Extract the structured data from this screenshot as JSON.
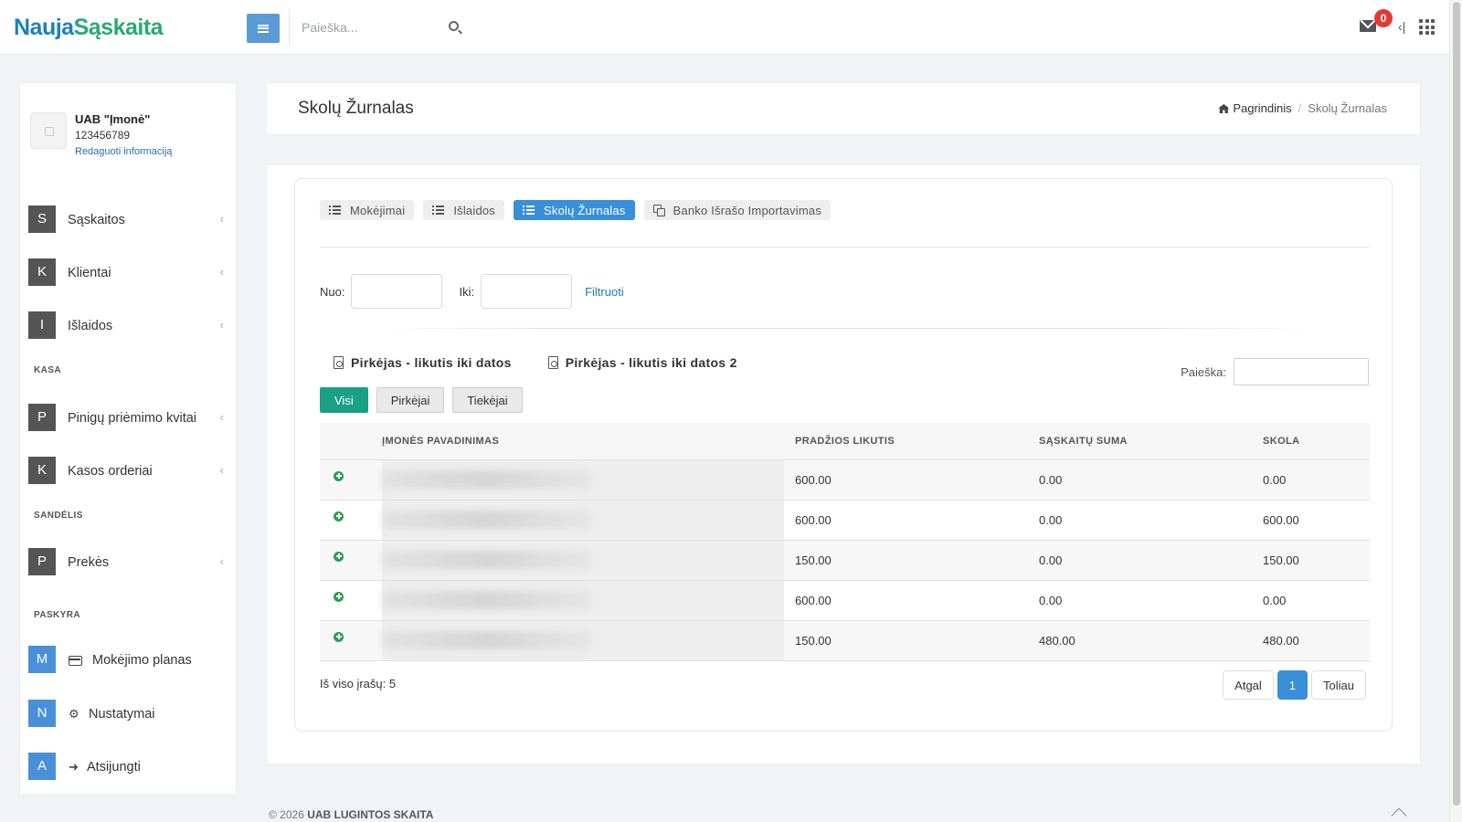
{
  "brand": {
    "part1": "Nauja",
    "part2": "Sąskaita"
  },
  "topbar": {
    "search_placeholder": "Paieška...",
    "mail_count": "0",
    "collapse_glyph": "‹|"
  },
  "profile": {
    "name": "UAB \"Įmonė\"",
    "code": "123456789",
    "edit_link": "Redaguoti informaciją"
  },
  "sidebar": {
    "items": [
      {
        "letter": "S",
        "label": "Sąskaitos"
      },
      {
        "letter": "K",
        "label": "Klientai"
      },
      {
        "letter": "I",
        "label": "Išlaidos"
      },
      {
        "letter": "P",
        "label": "Pinigų priėmimo kvitai"
      },
      {
        "letter": "K",
        "label": "Kasos orderiai"
      },
      {
        "letter": "P",
        "label": "Prekės"
      },
      {
        "letter": "M",
        "label": "Mokėjimo planas"
      },
      {
        "letter": "N",
        "label": "Nustatymai"
      },
      {
        "letter": "A",
        "label": "Atsijungti"
      }
    ],
    "sections": {
      "kasa": "KASA",
      "sandelis": "SANDĖLIS",
      "paskyra": "PASKYRA"
    }
  },
  "page": {
    "title": "Skolų Žurnalas",
    "breadcrumb": {
      "home": "Pagrindinis",
      "current": "Skolų Žurnalas"
    }
  },
  "tabs": [
    {
      "label": "Mokėjimai",
      "icon": "list-icon"
    },
    {
      "label": "Išlaidos",
      "icon": "list-icon"
    },
    {
      "label": "Skolų Žurnalas",
      "icon": "list-icon",
      "active": true
    },
    {
      "label": "Banko Išrašo Importavimas",
      "icon": "copy-icon"
    }
  ],
  "filter": {
    "from_label": "Nuo:",
    "to_label": "Iki:",
    "from_value": "",
    "to_value": "",
    "button": "Filtruoti"
  },
  "reports": [
    "Pirkėjas - likutis iki datos",
    "Pirkėjas - likutis iki datos 2"
  ],
  "table_search": {
    "label": "Paieška:",
    "value": ""
  },
  "segments": [
    "Visi",
    "Pirkėjai",
    "Tiekėjai"
  ],
  "active_segment": "Visi",
  "table": {
    "headers": [
      "",
      "ĮMONĖS PAVADINIMAS",
      "PRADŽIOS LIKUTIS",
      "SĄSKAITŲ SUMA",
      "SKOLA"
    ],
    "rows": [
      {
        "start": "600.00",
        "sum": "0.00",
        "debt": "0.00",
        "debt_status": "paid"
      },
      {
        "start": "600.00",
        "sum": "0.00",
        "debt": "600.00",
        "debt_status": "due"
      },
      {
        "start": "150.00",
        "sum": "0.00",
        "debt": "150.00",
        "debt_status": "due"
      },
      {
        "start": "600.00",
        "sum": "0.00",
        "debt": "0.00",
        "debt_status": "paid"
      },
      {
        "start": "150.00",
        "sum": "480.00",
        "debt": "480.00",
        "debt_status": "due"
      }
    ]
  },
  "total_records": "Iš viso įrašų: 5",
  "pager": {
    "prev": "Atgal",
    "current": "1",
    "next": "Toliau"
  },
  "footer": {
    "year": "© 2026",
    "company": "UAB LUGINTOS SKAITA"
  },
  "colors": {
    "primary": "#3a8fd9",
    "success": "#1aa086",
    "danger": "#e05252",
    "badge": "#e53935"
  }
}
